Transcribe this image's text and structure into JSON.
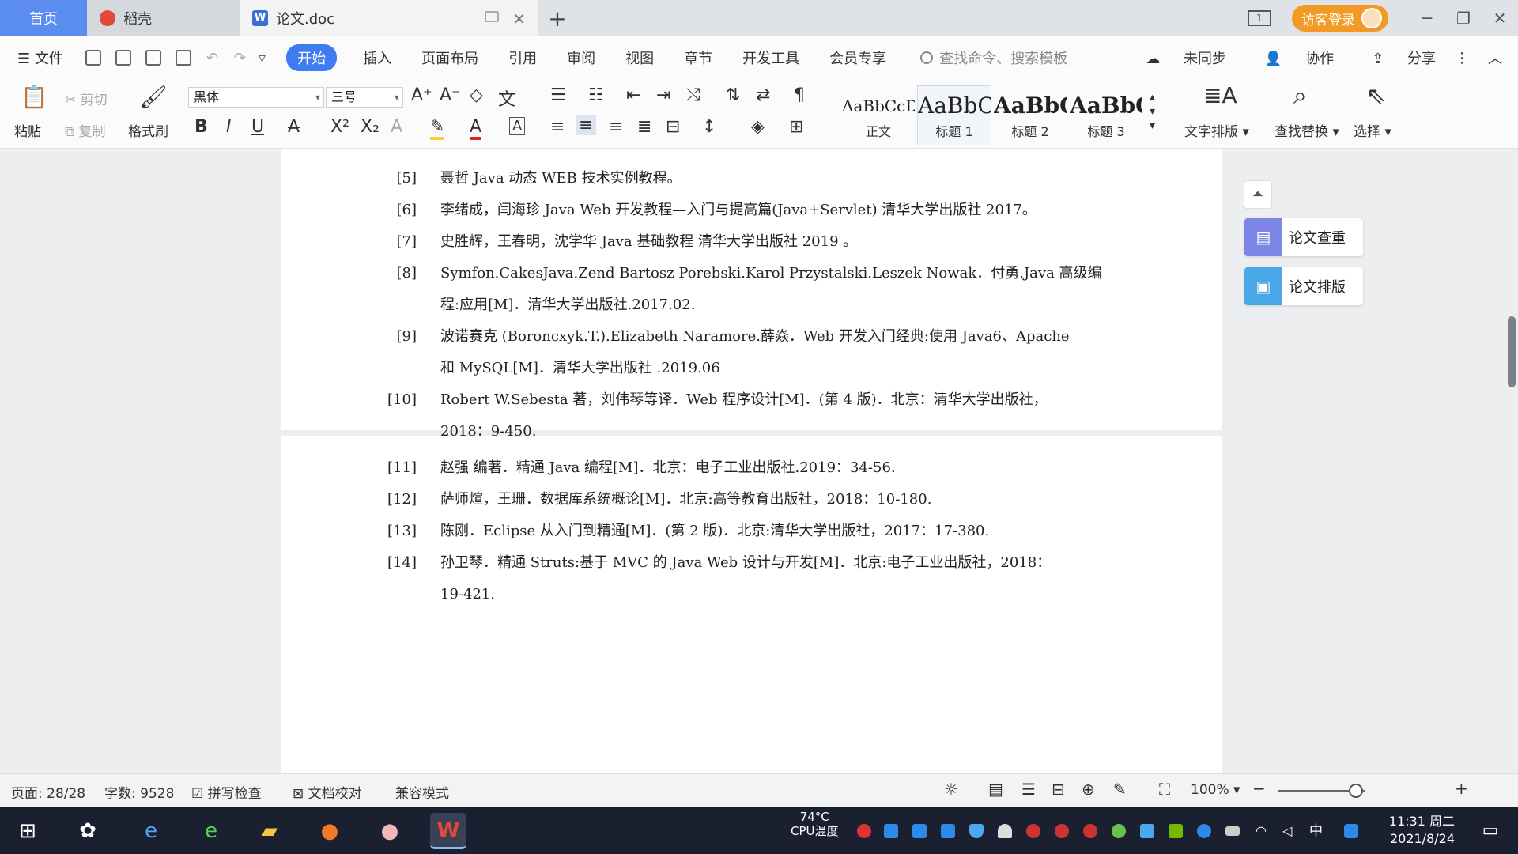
{
  "tabs": {
    "home": "首页",
    "daoke": "稻壳",
    "doc": "论文.doc",
    "doc_icon": "W",
    "new_tab": "+"
  },
  "titlebar": {
    "layout_badge": "1",
    "login": "访客登录",
    "minimize": "─",
    "restore": "❐",
    "close": "✕"
  },
  "menu": {
    "file": "文件",
    "items": [
      "开始",
      "插入",
      "页面布局",
      "引用",
      "审阅",
      "视图",
      "章节",
      "开发工具",
      "会员专享"
    ],
    "search_placeholder": "查找命令、搜索模板",
    "sync": "未同步",
    "collab": "协作",
    "share": "分享"
  },
  "ribbon": {
    "paste": "粘贴",
    "cut": "剪切",
    "copy": "复制",
    "format_painter": "格式刷",
    "font_name": "黑体",
    "font_size": "三号",
    "styles": [
      {
        "sample": "AaBbCcDd",
        "name": "正文"
      },
      {
        "sample": "AaBbC",
        "name": "标题 1"
      },
      {
        "sample": "AaBbC",
        "name": "标题 2"
      },
      {
        "sample": "AaBbC",
        "name": "标题 3"
      }
    ],
    "text_layout": "文字排版",
    "find_replace": "查找替换",
    "select": "选择"
  },
  "references": [
    {
      "num": "[5]",
      "lines": [
        "聂哲  Java 动态 WEB 技术实例教程。"
      ]
    },
    {
      "num": "[6]",
      "lines": [
        "李绪成，闫海珍  Java Web 开发教程—入门与提高篇(Java+Servlet)  清华大学出版社  2017。"
      ]
    },
    {
      "num": "[7]",
      "lines": [
        "史胜辉，王春明，沈学华  Java 基础教程  清华大学出版社  2019  。"
      ]
    },
    {
      "num": "[8]",
      "lines": [
        "Symfon.CakesJava.Zend Bartosz Porebski.Karol Przystalski.Leszek Nowak．付勇.Java 高级编",
        "程:应用[M]．清华大学出版社.2017.02."
      ]
    },
    {
      "num": "[9]",
      "lines": [
        " 波诺赛克  (Boroncxyk.T.).Elizabeth Naramore.薛焱．Web 开发入门经典:使用 Java6、Apache",
        "和 MySQL[M]．清华大学出版社  .2019.06"
      ]
    },
    {
      "num": "[10]",
      "lines": [
        "Robert W.Sebesta 著，刘伟琴等译．Web 程序设计[M]．(第 4 版)．北京：清华大学出版社，",
        "2018：9-450."
      ]
    },
    {
      "num": "[11]",
      "lines": [
        "赵强  编著．精通 Java 编程[M]．北京：电子工业出版社.2019：34-56."
      ]
    },
    {
      "num": "[12]",
      "lines": [
        "萨师煊，王珊．数据库系统概论[M]．北京:高等教育出版社，2018：10-180."
      ]
    },
    {
      "num": "[13]",
      "lines": [
        "陈刚．Eclipse 从入门到精通[M]．(第 2 版)．北京:清华大学出版社，2017：17-380."
      ]
    },
    {
      "num": "[14]",
      "lines": [
        "孙卫琴．精通 Struts:基于 MVC 的 Java Web 设计与开发[M]．北京:电子工业出版社，2018：",
        "19-421."
      ]
    }
  ],
  "side_panel": {
    "check": "论文查重",
    "layout": "论文排版"
  },
  "status": {
    "page": "页面: 28/28",
    "words": "字数: 9528",
    "spell": "拼写检查",
    "proof": "文档校对",
    "compat": "兼容模式",
    "zoom": "100%",
    "zoom_level_percent": 100
  },
  "taskbar": {
    "temp": "74°C",
    "temp_label": "CPU温度",
    "ime": "中",
    "time": "11:31 周二",
    "date": "2021/8/24"
  },
  "colors": {
    "accent": "#3e7cf0",
    "login": "#f19a25",
    "check_icon": "#7b86e6",
    "layout_icon": "#4aa8e8"
  }
}
